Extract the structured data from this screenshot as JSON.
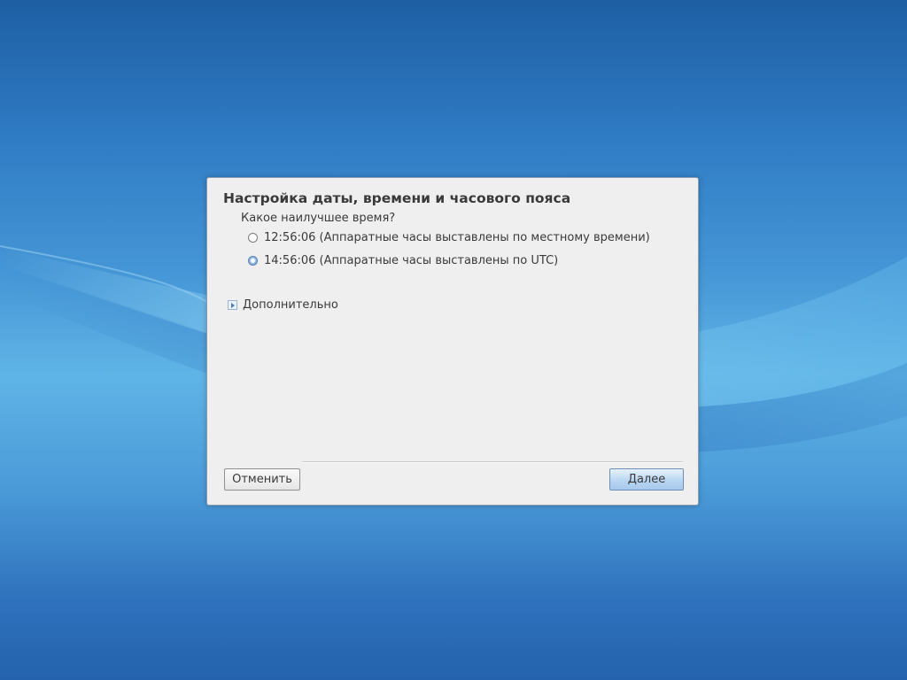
{
  "dialog": {
    "title": "Настройка даты, времени и часового пояса",
    "question": "Какое наилучшее время?",
    "options": [
      {
        "label": "12:56:06 (Аппаратные часы выставлены по местному времени)",
        "selected": false
      },
      {
        "label": "14:56:06 (Аппаратные часы выставлены по UTC)",
        "selected": true
      }
    ],
    "advanced_label": "Дополнительно",
    "cancel_label": "Отменить",
    "next_label": "Далее"
  },
  "colors": {
    "accent": "#5f91c8",
    "dialog_background": "#efefef",
    "text": "#3a3a3a"
  },
  "icons": {
    "radio_unselected": "radio-empty",
    "radio_selected": "radio-filled",
    "expander": "triangle-right"
  }
}
